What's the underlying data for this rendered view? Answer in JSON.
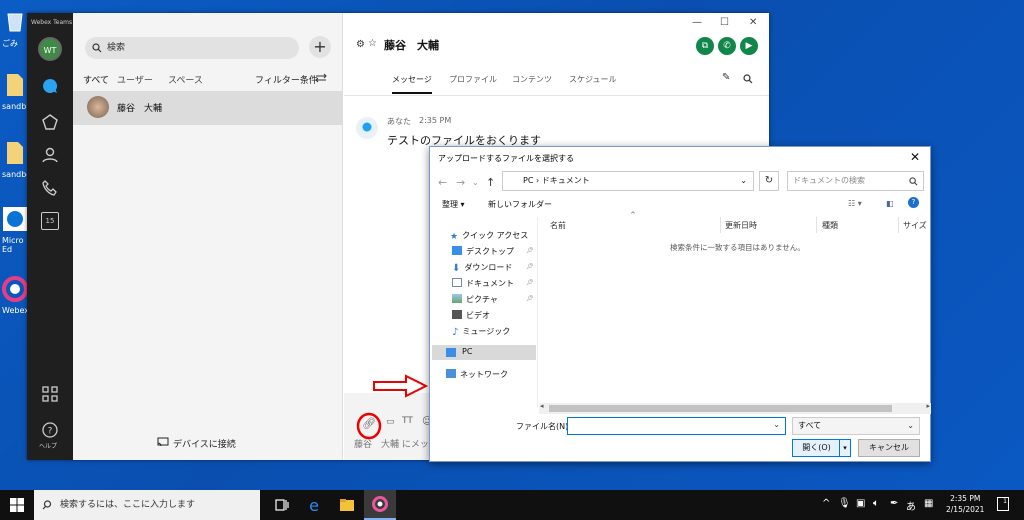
{
  "desktop": {
    "icons": [
      {
        "label": "ごみ"
      },
      {
        "label": "sandb"
      },
      {
        "label": "sandbo"
      },
      {
        "label": "Micro Ed"
      },
      {
        "label": "Webex"
      }
    ]
  },
  "webex": {
    "app_title": "Webex Teams",
    "avatar_initials": "WT",
    "help_label": "ヘルプ",
    "calendar_day": "15",
    "search_placeholder": "検索",
    "filters": {
      "all": "すべて",
      "users": "ユーザー",
      "spaces": "スペース",
      "filter_conditions": "フィルター条件"
    },
    "contact_name": "藤谷　大輔",
    "device_connect": "デバイスに接続",
    "space": {
      "name": "藤谷　大輔",
      "tabs": [
        "メッセージ",
        "プロファイル",
        "コンテンツ",
        "スケジュール"
      ]
    },
    "message": {
      "sender": "あなた",
      "time": "2:35 PM",
      "text": "テストのファイルをおくります"
    },
    "composer_placeholder": "藤谷　大輔 にメッセ"
  },
  "dialog": {
    "title": "アップロードするファイルを選択する",
    "address": "PC  ›  ドキュメント",
    "search_placeholder": "ドキュメントの検索",
    "organize": "整理 ▾",
    "new_folder": "新しいフォルダー",
    "columns": [
      "名前",
      "更新日時",
      "種類",
      "サイズ"
    ],
    "empty_message": "検索条件に一致する項目はありません。",
    "tree": [
      {
        "label": "クイック アクセス",
        "icon": "star-icon"
      },
      {
        "label": "デスクトップ",
        "icon": "desktop-icon",
        "pinned": true
      },
      {
        "label": "ダウンロード",
        "icon": "download-icon",
        "pinned": true
      },
      {
        "label": "ドキュメント",
        "icon": "document-icon",
        "pinned": true
      },
      {
        "label": "ピクチャ",
        "icon": "picture-icon",
        "pinned": true
      },
      {
        "label": "ビデオ",
        "icon": "video-icon"
      },
      {
        "label": "ミュージック",
        "icon": "music-icon"
      },
      {
        "label": "PC",
        "icon": "pc-icon"
      },
      {
        "label": "ネットワーク",
        "icon": "network-icon"
      }
    ],
    "filename_label": "ファイル名(N):",
    "filename_value": "",
    "filetype": "すべて",
    "open_button": "開く(O)",
    "cancel_button": "キャンセル"
  },
  "taskbar": {
    "search_placeholder": "検索するには、ここに入力します",
    "time": "2:35 PM",
    "date": "2/15/2021",
    "ime": "あ",
    "notifications": "1"
  }
}
